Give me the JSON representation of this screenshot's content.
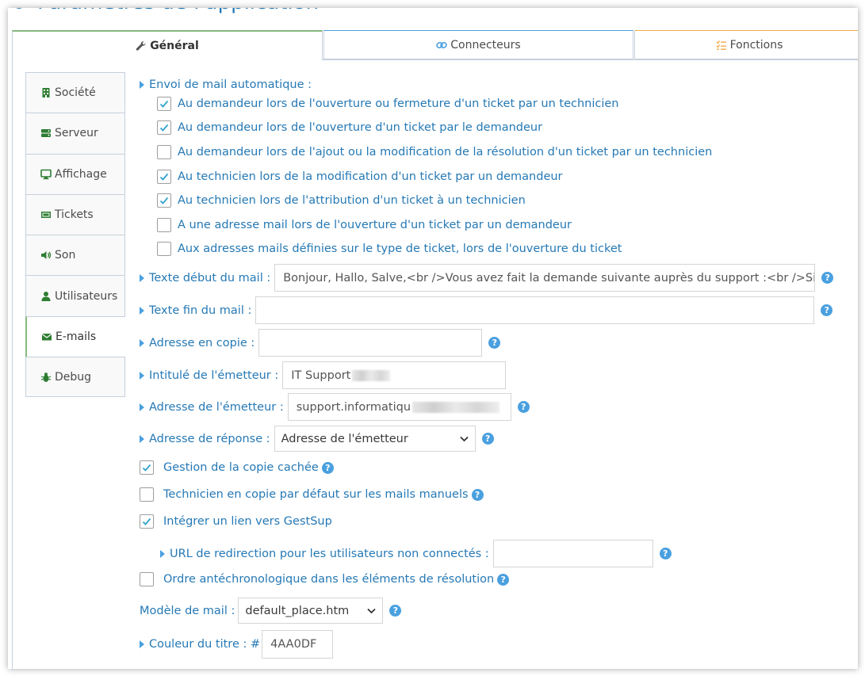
{
  "page": {
    "title": "Paramètres de l'application"
  },
  "top_tabs": [
    {
      "label": "Général",
      "icon": "wrench-icon"
    },
    {
      "label": "Connecteurs",
      "icon": "link-icon"
    },
    {
      "label": "Fonctions",
      "icon": "list-check-icon"
    }
  ],
  "side_tabs": [
    {
      "label": "Société",
      "icon": "building-icon"
    },
    {
      "label": "Serveur",
      "icon": "server-icon"
    },
    {
      "label": "Affichage",
      "icon": "monitor-icon"
    },
    {
      "label": "Tickets",
      "icon": "ticket-icon"
    },
    {
      "label": "Son",
      "icon": "volume-icon"
    },
    {
      "label": "Utilisateurs",
      "icon": "user-icon"
    },
    {
      "label": "E-mails",
      "icon": "envelope-icon"
    },
    {
      "label": "Debug",
      "icon": "bug-icon"
    }
  ],
  "auto_mail": {
    "label": "Envoi de mail automatique :",
    "options": [
      {
        "label": "Au demandeur lors de l'ouverture ou fermeture d'un ticket par un technicien",
        "checked": true
      },
      {
        "label": "Au demandeur lors de l'ouverture d'un ticket par le demandeur",
        "checked": true
      },
      {
        "label": "Au demandeur lors de l'ajout ou la modification de la résolution d'un ticket par un technicien",
        "checked": false
      },
      {
        "label": "Au technicien lors de la modification d'un ticket par un demandeur",
        "checked": true
      },
      {
        "label": "Au technicien lors de l'attribution d'un ticket à un technicien",
        "checked": true
      },
      {
        "label": "A une adresse mail lors de l'ouverture d'un ticket par un demandeur",
        "checked": false
      },
      {
        "label": "Aux adresses mails définies sur le type de ticket, lors de l'ouverture du ticket",
        "checked": false
      }
    ]
  },
  "fields": {
    "mail_start": {
      "label": "Texte début du mail :",
      "value": "Bonjour, Hallo, Salve,<br />Vous avez fait la demande suivante auprès du support :<br />Sie hab"
    },
    "mail_end": {
      "label": "Texte fin du mail :",
      "value": ""
    },
    "cc_address": {
      "label": "Adresse en copie :",
      "value": ""
    },
    "sender_name": {
      "label": "Intitulé de l'émetteur :",
      "value": "IT Support"
    },
    "sender_address": {
      "label": "Adresse de l'émetteur :",
      "value": "support.informatiqu"
    },
    "reply_address": {
      "label": "Adresse de réponse :",
      "value": "Adresse de l'émetteur"
    }
  },
  "options": {
    "bcc": {
      "label": "Gestion de la copie cachée",
      "checked": true
    },
    "tech_cc": {
      "label": "Technicien en copie par défaut sur les mails manuels",
      "checked": false
    },
    "gestsup_link": {
      "label": "Intégrer un lien vers GestSup",
      "checked": true
    },
    "redirect_url": {
      "label": "URL de redirection pour les utilisateurs non connectés :",
      "value": ""
    },
    "reverse_order": {
      "label": "Ordre antéchronologique dans les éléments de résolution",
      "checked": false
    }
  },
  "template": {
    "label": "Modèle de mail :",
    "value": "default_place.htm"
  },
  "title_color": {
    "label": "Couleur du titre : #",
    "value": "4AA0DF"
  },
  "help_glyph": "?",
  "colors": {
    "accent": "#2679b5",
    "brand": "#4aa0df",
    "active_tab": "#87b87f",
    "orange": "#f0ad4e"
  }
}
